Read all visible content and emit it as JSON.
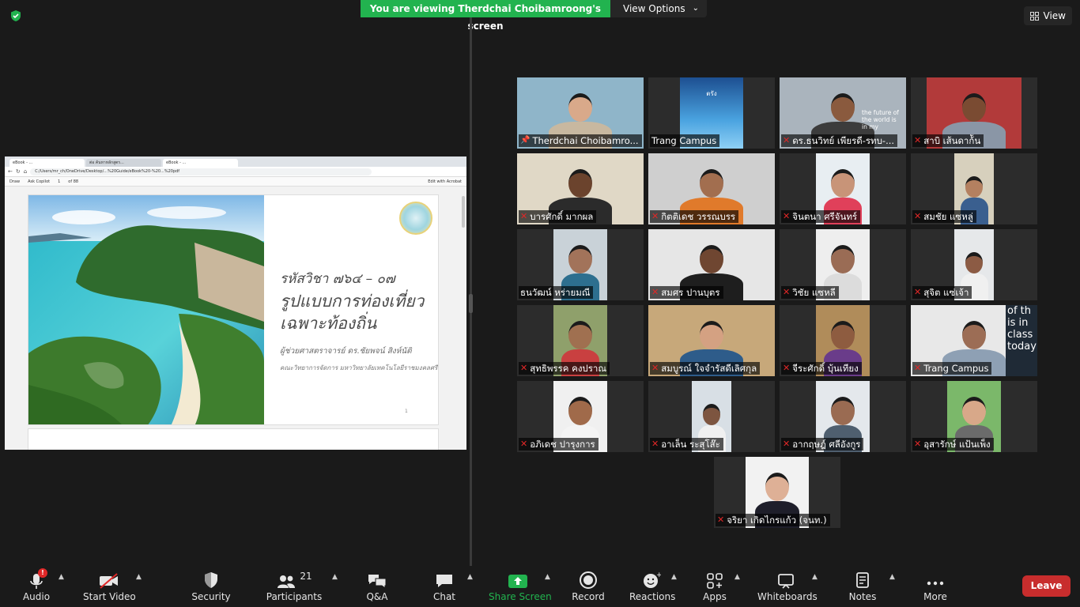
{
  "banner": {
    "viewing_text": "You are viewing Therdchai Choibamroong's screen",
    "view_options": "View Options",
    "view_button": "View"
  },
  "shared_screen": {
    "tabs": [
      "eBook - ...",
      "ต่อ ค้นหาหลักสูตร...",
      "eBook - ..."
    ],
    "url": "C:/Users/mr_ch/OneDrive/Desktop/...%20Guide/eBook%20-%20...%20pdf",
    "pdfbar": {
      "draw": "Draw",
      "ask": "Ask Copilot",
      "page": "1",
      "of": "of 88",
      "edit": "Edit with Acrobat"
    },
    "slide": {
      "code": "รหัสวิชา ๗๖๔ – ๐๗",
      "title_line1": "รูปแบบการท่องเที่ยว",
      "title_line2": "เฉพาะท้องถิ่น",
      "author": "ผู้ช่วยศาสตราจารย์ ดร.ชัยพจน์ สิงห์นัติ",
      "faculty": "คณะวิทยาการจัดการ มหาวิทยาลัยเทคโนโลยีราชมงคลศรีวิชัย",
      "page_number": "1"
    }
  },
  "participants": [
    {
      "name": "Therdchai Choibamro...",
      "muted": false,
      "pinned": true,
      "speaking": true
    },
    {
      "name": "Trang Campus",
      "muted": false
    },
    {
      "name": "ดร.ธนวิทย์ เพียรดี-รทบ-...",
      "muted": true
    },
    {
      "name": "สาบิ เส้นดาก้ัน",
      "muted": true
    },
    {
      "name": "บารศักดิ์ มากผล",
      "muted": true
    },
    {
      "name": "กิตติเดช วรรณบรร",
      "muted": true
    },
    {
      "name": "จินตนา ศรีจันทร์",
      "muted": true
    },
    {
      "name": "สมชัย แซหลู่",
      "muted": true
    },
    {
      "name": "ธนวัฒน์ หร่ายมณี",
      "muted": false
    },
    {
      "name": "สมศร ปานบุตร",
      "muted": true
    },
    {
      "name": "วิชัย แซหลี",
      "muted": true
    },
    {
      "name": "สุจิต แซ่เจ้า",
      "muted": true
    },
    {
      "name": "สุทธิพรรค คงปราณ",
      "muted": true
    },
    {
      "name": "สมบูรณ์ ใจจำรัสดีเลิศกุล",
      "muted": true
    },
    {
      "name": "จีระศักดิ์ บุ้นเทียง",
      "muted": true
    },
    {
      "name": "Trang Campus",
      "muted": true
    },
    {
      "name": "อภิเดช ปารุงการ",
      "muted": true
    },
    {
      "name": "อาเล็น ระสุโส๊ะ",
      "muted": true
    },
    {
      "name": "อากฤษฎ์ ศลีอังกูร",
      "muted": true
    },
    {
      "name": "อุสารักษ์ แป้นเพ็ง",
      "muted": true
    },
    {
      "name": "จริยา เกิดไกรแก้ว (จนท.)",
      "muted": true
    }
  ],
  "tile_texts": {
    "trang_poster": "ตรัง",
    "glass_text": "the future of the world is in my",
    "class_text": "of th is in class today"
  },
  "toolbar": {
    "audio": "Audio",
    "start_video": "Start Video",
    "security": "Security",
    "participants": "Participants",
    "participants_count": "21",
    "qa": "Q&A",
    "chat": "Chat",
    "share_screen": "Share Screen",
    "record": "Record",
    "reactions": "Reactions",
    "apps": "Apps",
    "whiteboards": "Whiteboards",
    "notes": "Notes",
    "more": "More",
    "leave": "Leave",
    "audio_badge": "!"
  },
  "colors": {
    "banner_green": "#22b34f",
    "speaking_border": "#c2d94a",
    "share_green": "#22b34f",
    "leave_red": "#c82d2d",
    "mute_red": "#e02828"
  }
}
